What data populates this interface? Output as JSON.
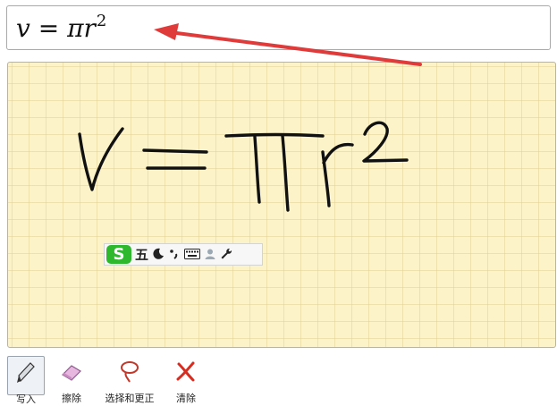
{
  "preview": {
    "formula_base": "v = πr",
    "formula_exponent": "2"
  },
  "ime": {
    "logo": "S",
    "mode": "五",
    "icons": [
      "moon-icon",
      "punctuation-icon",
      "keyboard-icon",
      "user-icon",
      "wrench-icon"
    ]
  },
  "toolbar": {
    "write_label": "写入",
    "erase_label": "擦除",
    "select_label": "选择和更正",
    "clear_label": "清除"
  },
  "colors": {
    "arrow": "#e03b3b",
    "ink": "#111111",
    "canvas_bg": "#fdf3c9",
    "ime_green": "#2eb82e"
  }
}
